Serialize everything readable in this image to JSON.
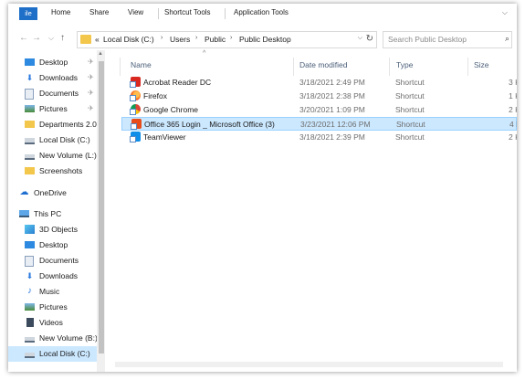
{
  "ribbon": {
    "file_label": "ile",
    "tabs": [
      "Home",
      "Share",
      "View",
      "Shortcut Tools",
      "Application Tools"
    ],
    "collapse_glyph": "⌵"
  },
  "address": {
    "back": "←",
    "forward": "→",
    "recent": "⌵",
    "up": "↑",
    "overflow": "«",
    "crumbs": [
      "Local Disk (C:)",
      "Users",
      "Public",
      "Public Desktop"
    ],
    "separator": "›",
    "dropdown": "⌵",
    "refresh": "↻"
  },
  "search": {
    "placeholder": "Search Public Desktop",
    "icon": "⌕"
  },
  "sidebar": {
    "items": [
      {
        "label": "Desktop",
        "icon": "desktop-icon",
        "pinned": true
      },
      {
        "label": "Downloads",
        "icon": "download-icon",
        "pinned": true
      },
      {
        "label": "Documents",
        "icon": "document-icon",
        "pinned": true
      },
      {
        "label": "Pictures",
        "icon": "pictures-icon",
        "pinned": true
      },
      {
        "label": "Departments 2.0",
        "icon": "folder-icon",
        "pinned": false
      },
      {
        "label": "Local Disk (C:)",
        "icon": "drive-icon",
        "pinned": false
      },
      {
        "label": "New Volume (L:)",
        "icon": "drive-icon",
        "pinned": false
      },
      {
        "label": "Screenshots",
        "icon": "folder-icon",
        "pinned": false
      },
      {
        "label": "OneDrive",
        "icon": "cloud-icon",
        "pinned": false
      },
      {
        "label": "This PC",
        "icon": "computer-icon",
        "pinned": false
      },
      {
        "label": "3D Objects",
        "icon": "cube-icon",
        "pinned": false
      },
      {
        "label": "Desktop",
        "icon": "desktop-icon",
        "pinned": false
      },
      {
        "label": "Documents",
        "icon": "document-icon",
        "pinned": false
      },
      {
        "label": "Downloads",
        "icon": "download-icon",
        "pinned": false
      },
      {
        "label": "Music",
        "icon": "music-icon",
        "pinned": false
      },
      {
        "label": "Pictures",
        "icon": "pictures-icon",
        "pinned": false
      },
      {
        "label": "Videos",
        "icon": "video-icon",
        "pinned": false
      },
      {
        "label": "New Volume (B:)",
        "icon": "drive-icon",
        "pinned": false
      },
      {
        "label": "Local Disk (C:)",
        "icon": "drive-icon",
        "pinned": false
      }
    ],
    "pin_glyph": "✈",
    "selected_index": 18
  },
  "columns": {
    "name": "Name",
    "date": "Date modified",
    "type": "Type",
    "size": "Size",
    "sort_glyph": "^"
  },
  "files": [
    {
      "name": "Acrobat Reader DC",
      "date": "3/18/2021 2:49 PM",
      "type": "Shortcut",
      "size": "3 K",
      "icon": "acrobat"
    },
    {
      "name": "Firefox",
      "date": "3/18/2021 2:38 PM",
      "type": "Shortcut",
      "size": "1 K",
      "icon": "firefox"
    },
    {
      "name": "Google Chrome",
      "date": "3/20/2021 1:09 PM",
      "type": "Shortcut",
      "size": "2 K",
      "icon": "chrome"
    },
    {
      "name": "Office 365 Login _ Microsoft Office (3)",
      "date": "3/23/2021 12:06 PM",
      "type": "Shortcut",
      "size": "4 K",
      "icon": "office"
    },
    {
      "name": "TeamViewer",
      "date": "3/18/2021 2:39 PM",
      "type": "Shortcut",
      "size": "2 K",
      "icon": "teamviewer"
    }
  ],
  "selected_file_index": 3,
  "colors": {
    "accent": "#1e6fc8",
    "selection": "#cce8ff",
    "selection_border": "#99d1ff",
    "folder": "#f3c74b"
  }
}
